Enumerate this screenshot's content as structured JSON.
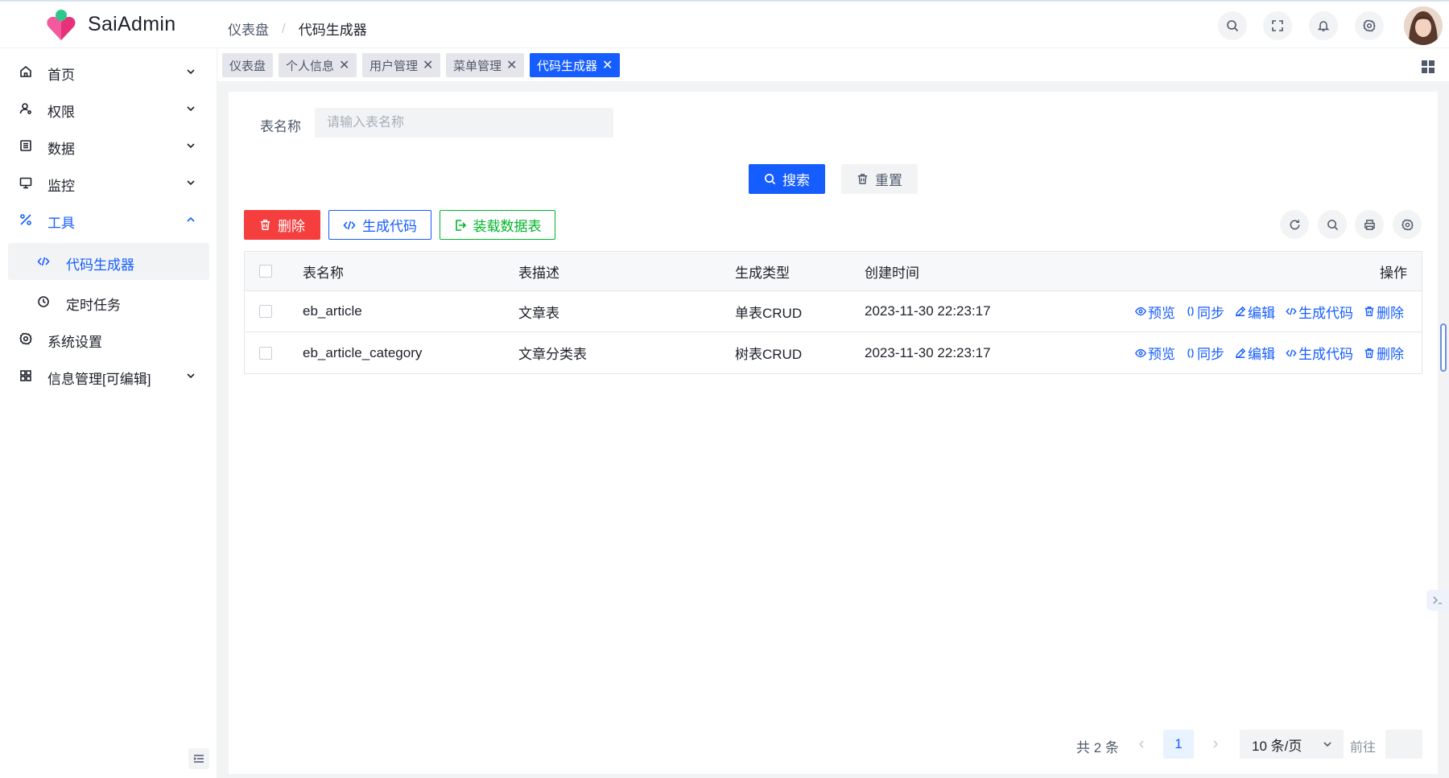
{
  "app": {
    "brand": "SaiAdmin"
  },
  "breadcrumb": [
    "仪表盘",
    "代码生成器"
  ],
  "header_icons": [
    "search-icon",
    "fullscreen-icon",
    "bell-icon",
    "gear-icon"
  ],
  "sidebar": {
    "items": [
      {
        "label": "首页",
        "icon": "home-icon",
        "expandable": true,
        "expanded": false
      },
      {
        "label": "权限",
        "icon": "user-icon",
        "expandable": true,
        "expanded": false
      },
      {
        "label": "数据",
        "icon": "list-icon",
        "expandable": true,
        "expanded": false
      },
      {
        "label": "监控",
        "icon": "monitor-icon",
        "expandable": true,
        "expanded": false
      },
      {
        "label": "工具",
        "icon": "tool-icon",
        "expandable": true,
        "expanded": true
      },
      {
        "label": "代码生成器",
        "icon": "code-icon",
        "sub": true,
        "selected": true
      },
      {
        "label": "定时任务",
        "icon": "clock-icon",
        "sub": true,
        "selected": false
      },
      {
        "label": "系统设置",
        "icon": "gear-icon",
        "expandable": false
      },
      {
        "label": "信息管理[可编辑]",
        "icon": "apps-icon",
        "expandable": true,
        "expanded": false
      }
    ]
  },
  "tabs": [
    {
      "label": "仪表盘",
      "closable": false,
      "active": false
    },
    {
      "label": "个人信息",
      "closable": true,
      "active": false
    },
    {
      "label": "用户管理",
      "closable": true,
      "active": false
    },
    {
      "label": "菜单管理",
      "closable": true,
      "active": false
    },
    {
      "label": "代码生成器",
      "closable": true,
      "active": true
    }
  ],
  "tab_close": "✕",
  "filter": {
    "label": "表名称",
    "placeholder": "请输入表名称",
    "value": "",
    "search_label": "搜索",
    "reset_label": "重置"
  },
  "toolbar": {
    "delete_label": "删除",
    "generate_label": "生成代码",
    "load_label": "装载数据表",
    "tool_icons": [
      "refresh-icon",
      "search-icon",
      "print-icon",
      "gear-icon"
    ]
  },
  "table": {
    "headers": [
      "表名称",
      "表描述",
      "生成类型",
      "创建时间",
      "操作"
    ],
    "rows": [
      {
        "table_name": "eb_article",
        "description": "文章表",
        "type": "单表CRUD",
        "created": "2023-11-30 22:23:17"
      },
      {
        "table_name": "eb_article_category",
        "description": "文章分类表",
        "type": "树表CRUD",
        "created": "2023-11-30 22:23:17"
      }
    ],
    "actions": [
      "预览",
      "同步",
      "编辑",
      "生成代码",
      "删除"
    ]
  },
  "pagination": {
    "total_text": "共 2 条",
    "current_page": "1",
    "page_size": "10 条/页",
    "goto_label": "前往"
  },
  "colors": {
    "primary": "#165dff",
    "danger": "#f53f3f",
    "success": "#00b42a",
    "bg": "#f2f3f5"
  }
}
